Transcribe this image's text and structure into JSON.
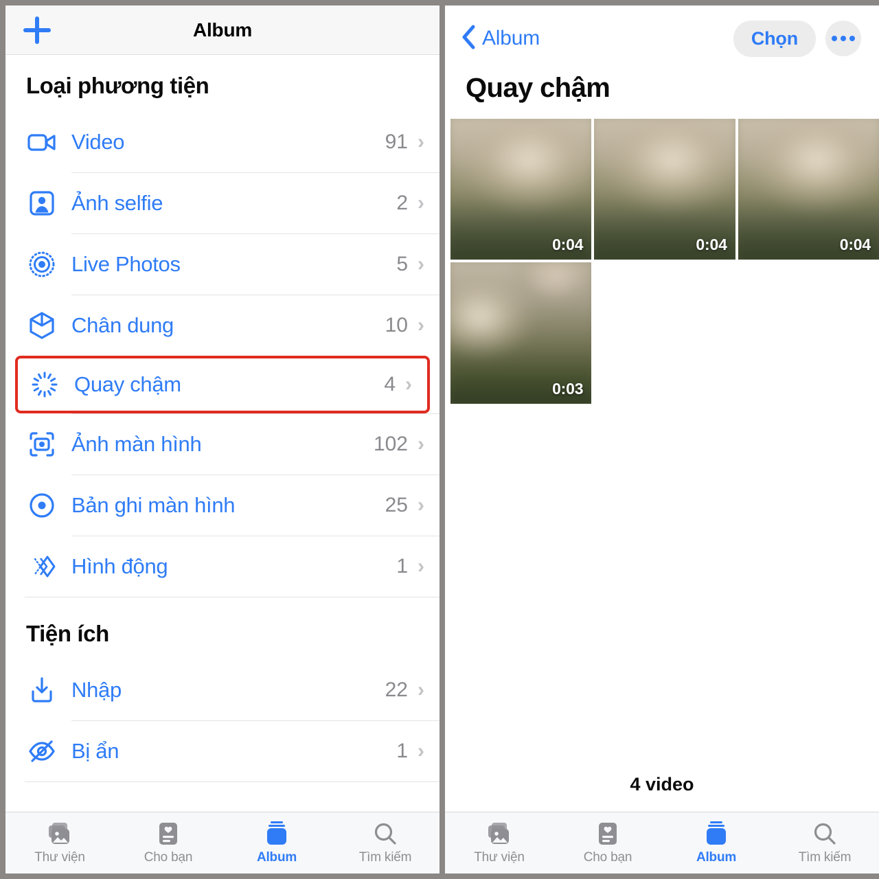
{
  "left_screen": {
    "nav": {
      "add_icon": "plus-icon",
      "title": "Album"
    },
    "sections": [
      {
        "header": "Loại phương tiện",
        "items": [
          {
            "icon": "video-camera-icon",
            "label": "Video",
            "count": "91"
          },
          {
            "icon": "person-portrait-icon",
            "label": "Ảnh selfie",
            "count": "2"
          },
          {
            "icon": "live-photos-icon",
            "label": "Live Photos",
            "count": "5"
          },
          {
            "icon": "cube-icon",
            "label": "Chân dung",
            "count": "10"
          },
          {
            "icon": "slow-motion-icon",
            "label": "Quay chậm",
            "count": "4",
            "highlighted": true
          },
          {
            "icon": "screenshot-icon",
            "label": "Ảnh màn hình",
            "count": "102"
          },
          {
            "icon": "screen-record-icon",
            "label": "Bản ghi màn hình",
            "count": "25"
          },
          {
            "icon": "animated-icon",
            "label": "Hình động",
            "count": "1"
          }
        ]
      },
      {
        "header": "Tiện ích",
        "items": [
          {
            "icon": "import-icon",
            "label": "Nhập",
            "count": "22"
          },
          {
            "icon": "eye-slash-icon",
            "label": "Bị ẩn",
            "count": "1"
          }
        ]
      }
    ],
    "tabs": [
      {
        "icon": "photos-library-icon",
        "label": "Thư viện",
        "active": false
      },
      {
        "icon": "for-you-icon",
        "label": "Cho bạn",
        "active": false
      },
      {
        "icon": "albums-icon",
        "label": "Album",
        "active": true
      },
      {
        "icon": "search-icon",
        "label": "Tìm kiếm",
        "active": false
      }
    ]
  },
  "right_screen": {
    "nav": {
      "back_icon": "chevron-left-icon",
      "back_label": "Album",
      "select_label": "Chọn",
      "more_icon": "ellipsis-icon"
    },
    "title": "Quay chậm",
    "thumbnails": [
      {
        "duration": "0:04"
      },
      {
        "duration": "0:04"
      },
      {
        "duration": "0:04"
      },
      {
        "duration": "0:03"
      }
    ],
    "count_caption": "4 video",
    "tabs": [
      {
        "icon": "photos-library-icon",
        "label": "Thư viện",
        "active": false
      },
      {
        "icon": "for-you-icon",
        "label": "Cho bạn",
        "active": false
      },
      {
        "icon": "albums-icon",
        "label": "Album",
        "active": true
      },
      {
        "icon": "search-icon",
        "label": "Tìm kiếm",
        "active": false
      }
    ]
  },
  "colors": {
    "accent": "#2f7cf6",
    "highlight_box": "#e02b20",
    "muted": "#8e8e93",
    "page_background": "#8a8784"
  }
}
